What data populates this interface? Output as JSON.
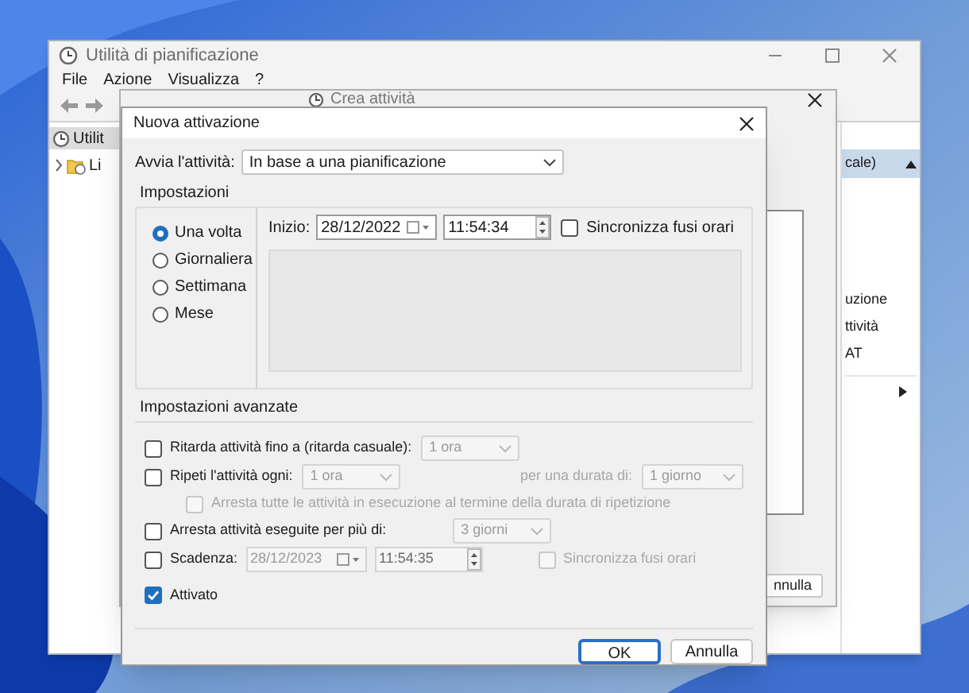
{
  "main_window": {
    "title": "Utilità di pianificazione",
    "menu": [
      "File",
      "Azione",
      "Visualizza",
      "?"
    ],
    "tree": [
      {
        "label": "Utilit",
        "selected": true,
        "children": [
          {
            "label": "Li",
            "selected": false,
            "expanded": false
          }
        ]
      }
    ],
    "actions_panel": {
      "header": "cale)",
      "items": [
        "uzione",
        "ttività",
        "AT"
      ]
    }
  },
  "create_task_dialog": {
    "title": "Crea attività",
    "button": "nnulla"
  },
  "trigger_dialog": {
    "title": "Nuova attivazione",
    "start_task": {
      "label": "Avvia l'attività:",
      "value": "In base a una pianificazione"
    },
    "settings": {
      "title": "Impostazioni",
      "schedule_options": [
        {
          "label": "Una volta",
          "selected": true
        },
        {
          "label": "Giornaliera",
          "selected": false
        },
        {
          "label": "Settimana",
          "selected": false
        },
        {
          "label": "Mese",
          "selected": false
        }
      ],
      "start": {
        "label": "Inizio:",
        "date": "28/12/2022",
        "time": "11:54:34"
      },
      "sync_time_zones": {
        "label": "Sincronizza fusi orari",
        "checked": false
      }
    },
    "advanced": {
      "title": "Impostazioni avanzate",
      "delay": {
        "label": "Ritarda attività fino a (ritarda casuale):",
        "checked": false,
        "value": "1 ora",
        "disabled": true
      },
      "repeat": {
        "label": "Ripeti l'attività ogni:",
        "checked": false,
        "value": "1 ora",
        "duration_label": "per una durata di:",
        "duration_value": "1 giorno",
        "disabled": true
      },
      "stop_all": {
        "label": "Arresta tutte le attività in esecuzione al termine della durata di ripetizione",
        "checked": false,
        "disabled": true
      },
      "stop_longer": {
        "label": "Arresta attività eseguite per più di:",
        "checked": false,
        "value": "3 giorni",
        "disabled": true
      },
      "expire": {
        "label": "Scadenza:",
        "checked": false,
        "date": "28/12/2023",
        "time": "11:54:35",
        "sync_label": "Sincronizza fusi orari",
        "sync_checked": false,
        "disabled": true
      },
      "enabled": {
        "label": "Attivato",
        "checked": true
      }
    },
    "buttons": [
      {
        "label": "OK",
        "default": true
      },
      {
        "label": "Annulla",
        "default": false
      }
    ]
  }
}
